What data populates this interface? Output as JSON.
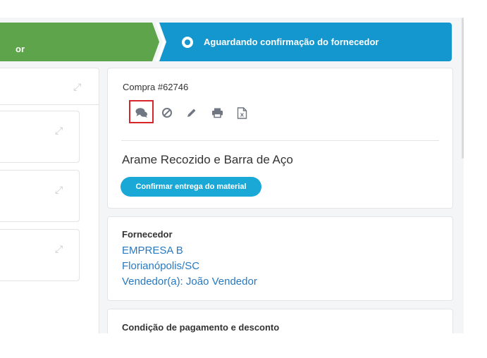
{
  "stepper": {
    "previous_step_label": "or",
    "current_step_label": "Aguardando confirmação do fornecedor"
  },
  "order": {
    "title": "Compra #62746",
    "product": "Arame Recozido e Barra de Aço",
    "confirm_button": "Confirmar entrega do material",
    "toolbar_icons": [
      "chat-icon",
      "cancel-icon",
      "edit-icon",
      "print-icon",
      "excel-export-icon"
    ]
  },
  "supplier": {
    "heading": "Fornecedor",
    "company": "EMPRESA B",
    "city": "Florianópolis/SC",
    "seller": "Vendedor(a): João Vendedor"
  },
  "payment": {
    "heading": "Condição de pagamento e desconto"
  },
  "colors": {
    "completed_step": "#5ea44a",
    "current_step": "#1496cf",
    "primary_button": "#1aa9d7",
    "link": "#2779c1",
    "highlight_box": "#d8252c"
  }
}
